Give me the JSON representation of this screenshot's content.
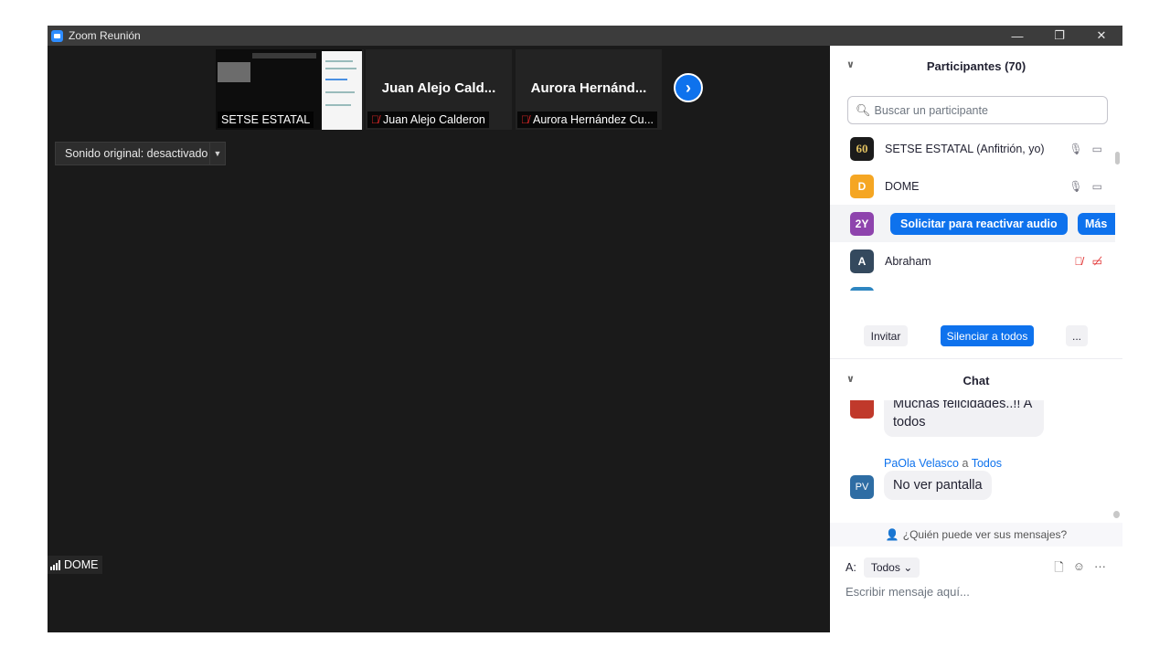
{
  "window": {
    "title": "Zoom Reunión"
  },
  "titlebar": {
    "minimize": "—",
    "restore": "❐",
    "close": "✕"
  },
  "video": {
    "thumbnails": [
      {
        "name": "",
        "label": "SETSE ESTATAL",
        "muted": false,
        "screen_share": true
      },
      {
        "name": "Juan Alejo Cald...",
        "label": "Juan Alejo Calderon",
        "muted": true
      },
      {
        "name": "Aurora Hernánd...",
        "label": "Aurora Hernández Cu...",
        "muted": true
      }
    ],
    "next_icon": "chevron-right-icon",
    "sound_original": "Sonido original: desactivado",
    "active_speaker": "DOME"
  },
  "participants": {
    "title": "Participantes (70)",
    "search_placeholder": "Buscar un participante",
    "list": [
      {
        "avatar": "60",
        "name": "SETSE ESTATAL (Anfitrión, yo)",
        "color": "#1b1b1b",
        "mic": "on",
        "cam": "on"
      },
      {
        "avatar": "D",
        "name": "DOME",
        "color": "#f5a623",
        "mic": "on",
        "cam": "on"
      },
      {
        "avatar": "2Y",
        "name": "",
        "color": "#8e44ad"
      },
      {
        "avatar": "A",
        "name": "Abraham",
        "color": "#34495e",
        "mic": "muted",
        "cam": "muted"
      }
    ],
    "request_unmute": "Solicitar para reactivar audio",
    "more": "Más",
    "invite": "Invitar",
    "mute_all": "Silenciar a todos",
    "more_options": "..."
  },
  "chat": {
    "title": "Chat",
    "messages": [
      {
        "text": "Muchas felicidades..!! A todos"
      },
      {
        "sender": "PaOla Velasco",
        "to_word": "a",
        "recipient": "Todos",
        "avatar": "PV",
        "avatar_color": "#2e6da4",
        "text": "No ver pantalla"
      }
    ],
    "who_can_see": "¿Quién puede ver sus mensajes?",
    "to_label": "A:",
    "to_value": "Todos",
    "placeholder": "Escribir mensaje aquí...",
    "more_icon": "···"
  }
}
